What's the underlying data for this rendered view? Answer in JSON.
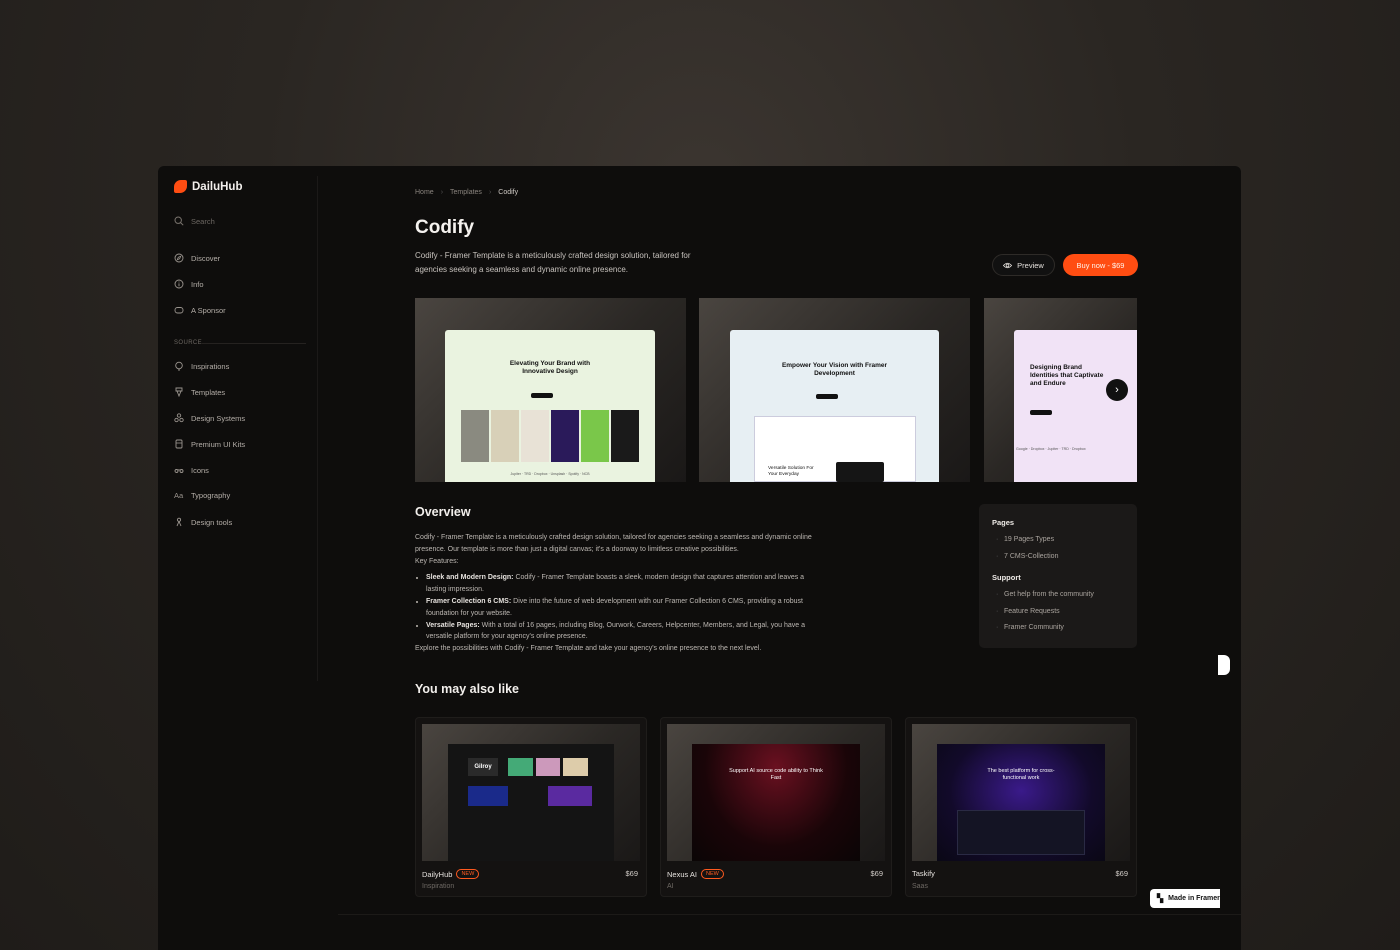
{
  "brand": {
    "name": "DailuHub",
    "accent": "#ff4d12"
  },
  "sidebar": {
    "search_placeholder": "Search",
    "nav": [
      {
        "label": "Discover",
        "icon": "compass-icon"
      },
      {
        "label": "Info",
        "icon": "info-icon"
      },
      {
        "label": "A Sponsor",
        "icon": "sponsor-icon"
      }
    ],
    "source_label": "SOURCE",
    "source_items": [
      {
        "label": "Inspirations",
        "icon": "bulb-icon"
      },
      {
        "label": "Templates",
        "icon": "template-icon"
      },
      {
        "label": "Design Systems",
        "icon": "shapes-icon"
      },
      {
        "label": "Premium UI Kits",
        "icon": "kit-icon"
      },
      {
        "label": "Icons",
        "icon": "icons-icon"
      },
      {
        "label": "Typography",
        "icon": "type-icon"
      },
      {
        "label": "Design tools",
        "icon": "tools-icon"
      }
    ]
  },
  "breadcrumb": {
    "home": "Home",
    "section": "Templates",
    "current": "Codify"
  },
  "product": {
    "title": "Codify",
    "subtitle": "Codify - Framer Template is a meticulously crafted design solution, tailored for agencies seeking a seamless and dynamic online presence.",
    "preview_label": "Preview",
    "buy_label": "Buy now - $69"
  },
  "screenshots": [
    {
      "heading": "Elevating Your Brand with Innovative Design",
      "logos": "Jupiter · TRD · Dropbox · Unsplash · Spotify · NCB"
    },
    {
      "heading": "Empower Your Vision with Framer Development",
      "sub": "Versatile Solution For Your Everyday"
    },
    {
      "heading": "Designing Brand Identities that Captivate and Endure",
      "logos": "Google · Dropbox · Jupiter · TRD · Dropbox"
    }
  ],
  "overview": {
    "heading": "Overview",
    "intro": "Codify - Framer Template is a meticulously crafted design solution, tailored for agencies seeking a seamless and dynamic online presence. Our template is more than just a digital canvas; it's a doorway to limitless creative possibilities.",
    "features_label": "Key Features:",
    "features": [
      {
        "title": "Sleek and Modern Design:",
        "text": " Codify - Framer Template boasts a sleek, modern design that captures attention and leaves a lasting impression."
      },
      {
        "title": "Framer Collection 6 CMS:",
        "text": " Dive into the future of web development with our Framer Collection 6 CMS, providing a robust foundation for your website."
      },
      {
        "title": "Versatile Pages:",
        "text": " With a total of 16 pages, including Blog, Ourwork, Careers, Helpcenter, Members, and Legal, you have a versatile platform for your agency's online presence."
      }
    ],
    "outro": "Explore the possibilities with Codify - Framer Template and take your agency's online presence to the next level."
  },
  "infobox": {
    "pages_label": "Pages",
    "pages": [
      "19 Pages Types",
      "7 CMS-Collection"
    ],
    "support_label": "Support",
    "support": [
      "Get help from the community",
      "Feature Requests",
      "Framer Community"
    ]
  },
  "related": {
    "heading": "You may also like",
    "items": [
      {
        "name": "DailyHub",
        "badge": "NEW",
        "category": "Inspiration",
        "price": "$69",
        "thumb_text": "Gilroy"
      },
      {
        "name": "Nexus AI",
        "badge": "NEW",
        "category": "AI",
        "price": "$69",
        "thumb_text": "Support AI source code ability to Think Fast"
      },
      {
        "name": "Taskify",
        "badge": "",
        "category": "Saas",
        "price": "$69",
        "thumb_text": "The best platform for cross-functional work"
      }
    ]
  },
  "made_in": "Made in Framer"
}
